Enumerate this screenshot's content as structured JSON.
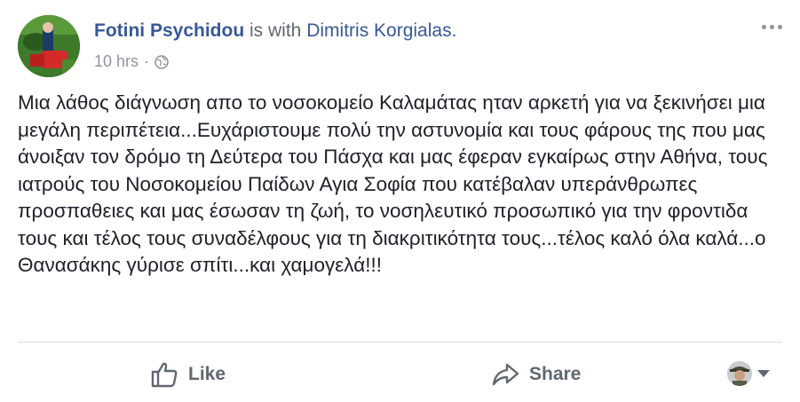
{
  "post": {
    "author": "Fotini Psychidou",
    "with_text": "is with",
    "tagged_user": "Dimitris Korgialas.",
    "time": "10 hrs",
    "separator": "·",
    "privacy_icon": "globe-icon",
    "body": "Μια λάθος διάγνωση απο το νοσοκομείο Καλαμάτας ηταν αρκετή για να ξεκινήσει μια μεγάλη περιπέτεια...Ευχάριστουμε πολύ την αστυνομία και τους φάρους της που μας άνοιξαν τον δρόμο τη Δεύτερα του Πάσχα και μας έφεραν εγκαίρως στην Αθήνα, τους ιατρούς του Νοσοκομείου Παίδων Αγια Σοφία που κατέβαλαν υπεράνθρωπες προσπαθειες και μας έσωσαν τη ζωή, το νοσηλευτικό προσωπικό για την φροντιδα τους και τέλος τους συναδέλφους για τη διακριτικότητα τους...τέλος καλό όλα καλά...ο Θανασάκης γύρισε σπίτι...και χαμογελά!!!"
  },
  "actions": {
    "like_label": "Like",
    "share_label": "Share"
  },
  "colors": {
    "link": "#385898",
    "muted": "#90949c",
    "text": "#1d2129",
    "action": "#606770"
  }
}
